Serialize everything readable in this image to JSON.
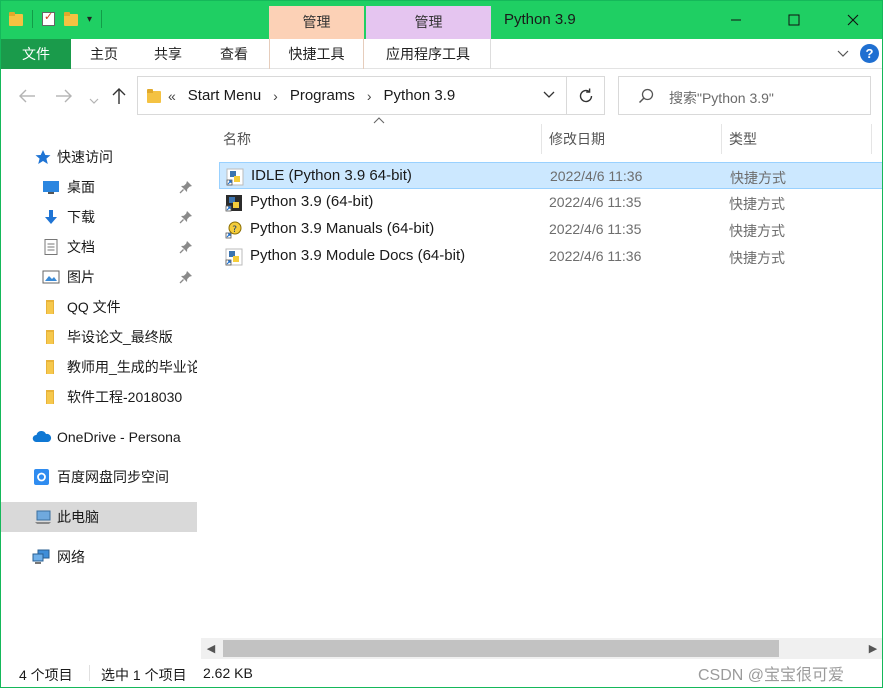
{
  "title_bar": {
    "title": "Python 3.9",
    "context_tab_1": "管理",
    "context_tab_2": "管理"
  },
  "ribbon": {
    "tabs": [
      "文件",
      "主页",
      "共享",
      "查看",
      "快捷工具",
      "应用程序工具"
    ]
  },
  "address_bar": {
    "breadcrumbs": [
      "«",
      "Start Menu",
      "Programs",
      "Python 3.9"
    ]
  },
  "search": {
    "placeholder": "搜索\"Python 3.9\""
  },
  "sidebar": {
    "items": [
      {
        "label": "快速访问",
        "icon": "star-icon"
      },
      {
        "label": "桌面",
        "icon": "desktop-icon",
        "pinned": true
      },
      {
        "label": "下载",
        "icon": "download-icon",
        "pinned": true
      },
      {
        "label": "文档",
        "icon": "document-icon",
        "pinned": true
      },
      {
        "label": "图片",
        "icon": "picture-icon",
        "pinned": true
      },
      {
        "label": "QQ 文件",
        "icon": "folder-icon"
      },
      {
        "label": "毕设论文_最终版",
        "icon": "folder-icon"
      },
      {
        "label": "教师用_生成的毕业论",
        "icon": "folder-icon"
      },
      {
        "label": "软件工程-2018030",
        "icon": "folder-icon"
      },
      {
        "label": "OneDrive - Persona",
        "icon": "cloud-icon"
      },
      {
        "label": "百度网盘同步空间",
        "icon": "baidu-netdisk-icon"
      },
      {
        "label": "此电脑",
        "icon": "computer-icon",
        "selected": true
      },
      {
        "label": "网络",
        "icon": "network-icon"
      }
    ]
  },
  "file_list": {
    "columns": [
      "名称",
      "修改日期",
      "类型"
    ],
    "rows": [
      {
        "name": "IDLE (Python 3.9 64-bit)",
        "date": "2022/4/6 11:36",
        "type": "快捷方式",
        "selected": true,
        "icon": "python-shortcut-icon"
      },
      {
        "name": "Python 3.9 (64-bit)",
        "date": "2022/4/6 11:35",
        "type": "快捷方式",
        "icon": "python-console-icon"
      },
      {
        "name": "Python 3.9 Manuals (64-bit)",
        "date": "2022/4/6 11:35",
        "type": "快捷方式",
        "icon": "python-help-icon"
      },
      {
        "name": "Python 3.9 Module Docs (64-bit)",
        "date": "2022/4/6 11:36",
        "type": "快捷方式",
        "icon": "python-shortcut-icon"
      }
    ]
  },
  "status_bar": {
    "item_count": "4 个项目",
    "selection": "选中 1 个项目",
    "size": "2.62 KB"
  },
  "watermark": "CSDN @宝宝很可爱",
  "colors": {
    "title_bar": "#1fcf63",
    "file_tab": "#1a9b4b",
    "selection": "#cce8ff",
    "context_tab_1": "#fcd1b6",
    "context_tab_2": "#e5c5f0"
  }
}
